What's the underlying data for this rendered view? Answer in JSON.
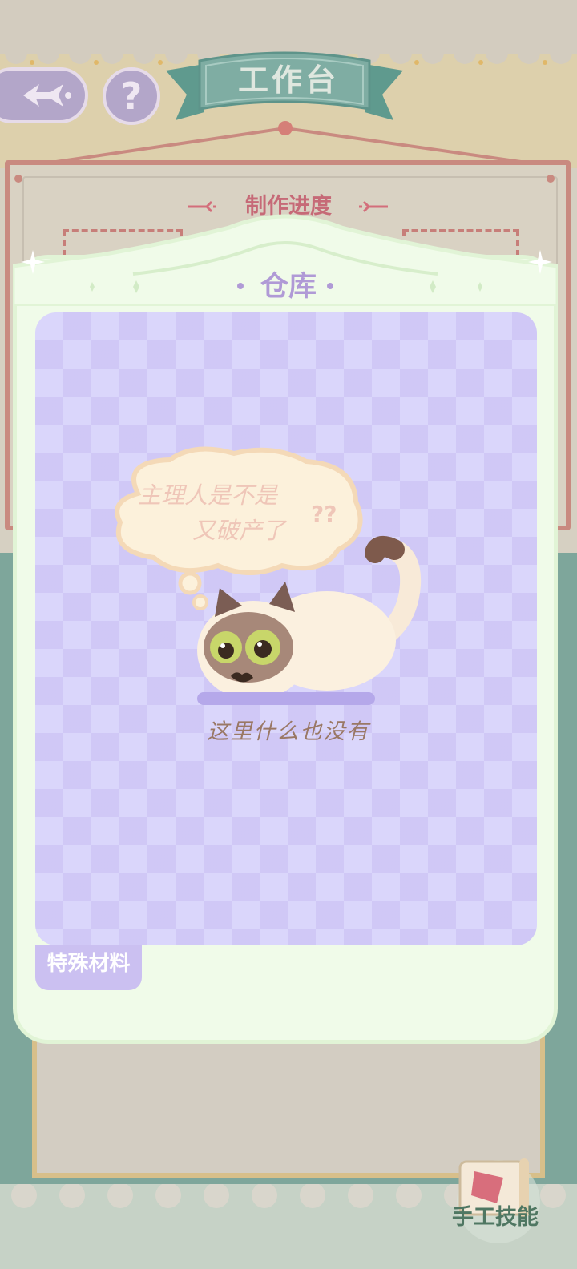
{
  "header": {
    "title": "工作台",
    "help_symbol": "?"
  },
  "board": {
    "progress_title": "制作进度"
  },
  "warehouse": {
    "title": "仓库",
    "thought_text_line1": "主理人是不是",
    "thought_text_line2": "又破产了",
    "thought_marks": "??",
    "empty_text": "这里什么也没有",
    "tabs": [
      {
        "label": "特殊材料",
        "selected": true
      }
    ]
  },
  "footer": {
    "craft_skill_label": "手工技能"
  },
  "colors": {
    "accent_purple": "#b09ad6",
    "ribbon_teal": "#7fada3",
    "board_pink": "#c98a80",
    "panel_green": "#f0fbe9"
  }
}
